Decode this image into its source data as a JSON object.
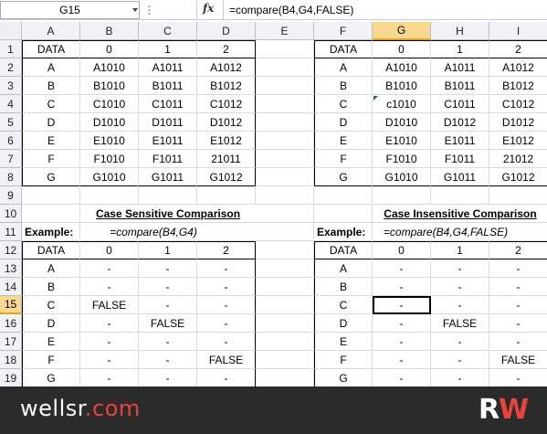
{
  "formula_bar": {
    "name_box": "G15",
    "fx_label": "fx",
    "formula": "=compare(B4,G4,FALSE)"
  },
  "columns": [
    "A",
    "B",
    "C",
    "D",
    "E",
    "F",
    "G",
    "H",
    "I"
  ],
  "selected_column": "G",
  "selected_row": "15",
  "rows": [
    {
      "num": "1",
      "cells": [
        "DATA",
        "0",
        "1",
        "2",
        "",
        "DATA",
        "0",
        "1",
        "2"
      ]
    },
    {
      "num": "2",
      "cells": [
        "A",
        "A1010",
        "A1011",
        "A1012",
        "",
        "A",
        "A1010",
        "A1011",
        "A1012"
      ]
    },
    {
      "num": "3",
      "cells": [
        "B",
        "B1010",
        "B1011",
        "B1012",
        "",
        "B",
        "B1010",
        "B1011",
        "B1012"
      ]
    },
    {
      "num": "4",
      "cells": [
        "C",
        "C1010",
        "C1011",
        "C1012",
        "",
        "C",
        "c1010",
        "C1011",
        "C1012"
      ]
    },
    {
      "num": "5",
      "cells": [
        "D",
        "D1010",
        "D1011",
        "D1012",
        "",
        "D",
        "D1010",
        "D1012",
        "D1012"
      ]
    },
    {
      "num": "6",
      "cells": [
        "E",
        "E1010",
        "E1011",
        "E1012",
        "",
        "E",
        "E1010",
        "E1011",
        "E1012"
      ]
    },
    {
      "num": "7",
      "cells": [
        "F",
        "F1010",
        "F1011",
        "21011",
        "",
        "F",
        "F1010",
        "F1011",
        "21012"
      ]
    },
    {
      "num": "8",
      "cells": [
        "G",
        "G1010",
        "G1011",
        "G1012",
        "",
        "G",
        "G1010",
        "G1011",
        "G1012"
      ]
    },
    {
      "num": "9",
      "cells": [
        "",
        "",
        "",
        "",
        "",
        "",
        "",
        "",
        ""
      ]
    },
    {
      "num": "10",
      "cells": [
        "",
        "Case Sensitive Comparison",
        "",
        "",
        "",
        "",
        "Case Insensitive Comparison",
        "",
        ""
      ]
    },
    {
      "num": "11",
      "cells": [
        "Example:",
        "=compare(B4,G4)",
        "",
        "",
        "",
        "Example:",
        "=compare(B4,G4,FALSE)",
        "",
        ""
      ]
    },
    {
      "num": "12",
      "cells": [
        "DATA",
        "0",
        "1",
        "2",
        "",
        "DATA",
        "0",
        "1",
        "2"
      ]
    },
    {
      "num": "13",
      "cells": [
        "A",
        "-",
        "-",
        "-",
        "",
        "A",
        "-",
        "-",
        "-"
      ]
    },
    {
      "num": "14",
      "cells": [
        "B",
        "-",
        "-",
        "-",
        "",
        "B",
        "-",
        "-",
        "-"
      ]
    },
    {
      "num": "15",
      "cells": [
        "C",
        "FALSE",
        "-",
        "-",
        "",
        "C",
        "-",
        "-",
        "-"
      ]
    },
    {
      "num": "16",
      "cells": [
        "D",
        "-",
        "FALSE",
        "-",
        "",
        "D",
        "-",
        "FALSE",
        "-"
      ]
    },
    {
      "num": "17",
      "cells": [
        "E",
        "-",
        "-",
        "-",
        "",
        "E",
        "-",
        "-",
        "-"
      ]
    },
    {
      "num": "18",
      "cells": [
        "F",
        "-",
        "-",
        "FALSE",
        "",
        "F",
        "-",
        "-",
        "FALSE"
      ]
    },
    {
      "num": "19",
      "cells": [
        "G",
        "-",
        "-",
        "-",
        "",
        "G",
        "-",
        "-",
        "-"
      ]
    }
  ],
  "banner": {
    "brand_name": "wellsr",
    "brand_tld": ".com",
    "logo_r": "R",
    "logo_w": "W"
  },
  "colors": {
    "selection_header": "#f9d98f",
    "banner_bg": "#2b2b2b",
    "brand_accent": "#e8433c",
    "error_indicator": "#1a7a32"
  }
}
